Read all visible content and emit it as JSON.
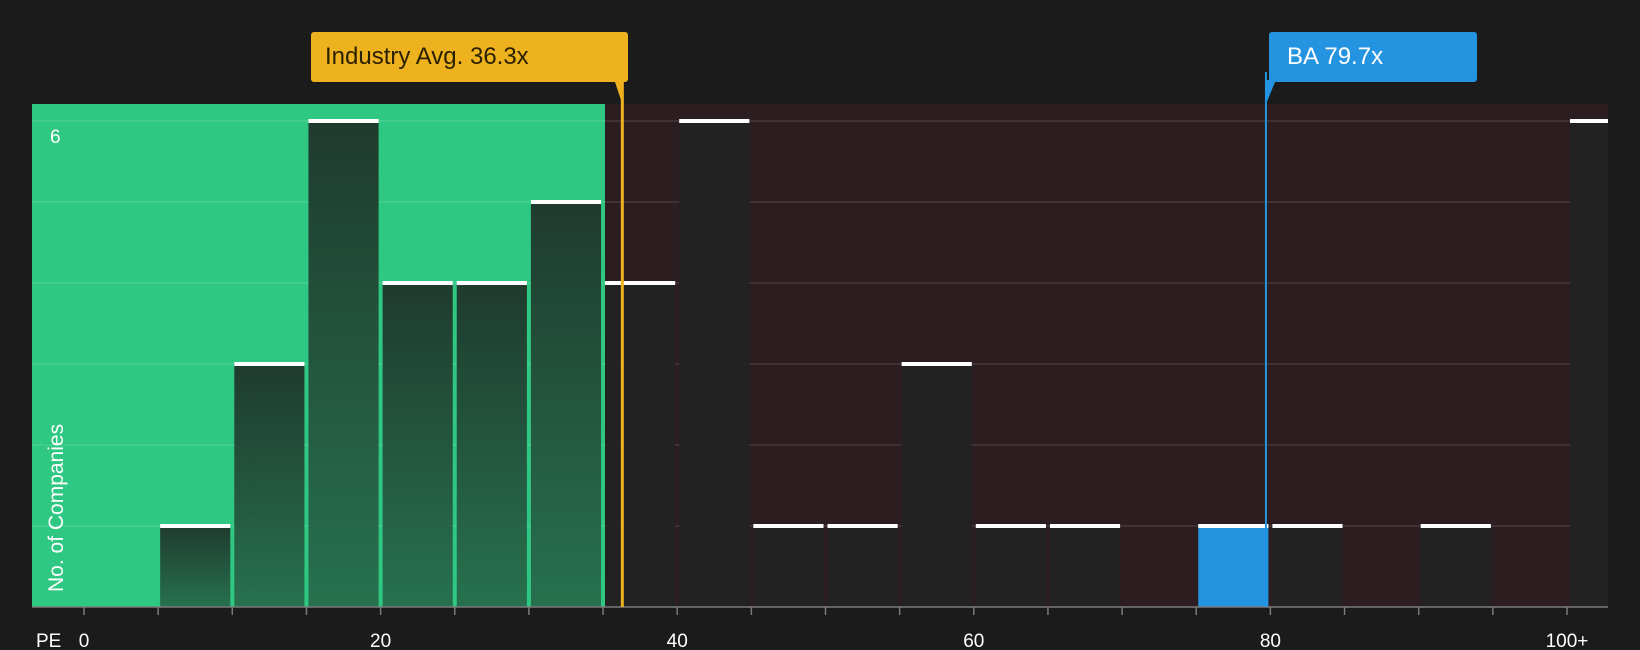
{
  "chart_data": {
    "type": "bar",
    "x_axis_title": "PE",
    "y_axis_title": "No. of Companies",
    "x_ticks": [
      "0",
      "20",
      "40",
      "60",
      "80",
      "100+"
    ],
    "y_ticks": [
      "6"
    ],
    "ylim": [
      0,
      6.2
    ],
    "bin_width": 5,
    "bins": [
      {
        "start": 0,
        "count": 0
      },
      {
        "start": 5,
        "count": 1
      },
      {
        "start": 10,
        "count": 3
      },
      {
        "start": 15,
        "count": 6
      },
      {
        "start": 20,
        "count": 4
      },
      {
        "start": 25,
        "count": 4
      },
      {
        "start": 30,
        "count": 5
      },
      {
        "start": 35,
        "count": 4
      },
      {
        "start": 40,
        "count": 6
      },
      {
        "start": 45,
        "count": 1
      },
      {
        "start": 50,
        "count": 1
      },
      {
        "start": 55,
        "count": 3
      },
      {
        "start": 60,
        "count": 1
      },
      {
        "start": 65,
        "count": 1
      },
      {
        "start": 70,
        "count": 0
      },
      {
        "start": 75,
        "count": 1,
        "highlight": true
      },
      {
        "start": 80,
        "count": 1
      },
      {
        "start": 85,
        "count": 0
      },
      {
        "start": 90,
        "count": 1
      },
      {
        "start": 95,
        "count": 0
      },
      {
        "start": 100,
        "count": 6
      }
    ],
    "industry_avg": {
      "value": 36.3,
      "label": "Industry Avg. 36.3x"
    },
    "company": {
      "value": 79.7,
      "label": "BA 79.7x"
    },
    "colors": {
      "background": "#1b1b1c",
      "undervalued_zone": "#2fc882",
      "overvalued_zone": "#2c1e20",
      "bar_dark": "#222222",
      "bar_in_green": "#234a37",
      "highlight_bar": "#2493e0",
      "avg_line": "#efb21f",
      "company_line": "#2493e0"
    }
  }
}
